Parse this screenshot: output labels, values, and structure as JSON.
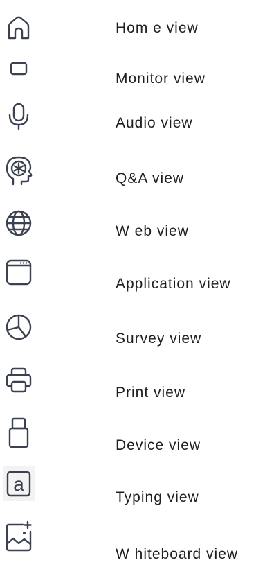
{
  "views": [
    {
      "label": "Hom e view",
      "icon": "home-icon"
    },
    {
      "label": "Monitor view",
      "icon": "monitor-icon"
    },
    {
      "label": "Audio view",
      "icon": "microphone-icon"
    },
    {
      "label": "Q&A view",
      "icon": "head-asterisk-icon"
    },
    {
      "label": "W eb view",
      "icon": "globe-icon"
    },
    {
      "label": "Application view",
      "icon": "application-window-icon"
    },
    {
      "label": "Survey view",
      "icon": "pie-chart-icon"
    },
    {
      "label": "Print view",
      "icon": "printer-icon"
    },
    {
      "label": "Device view",
      "icon": "usb-device-icon"
    },
    {
      "label": "Typing view",
      "icon": "letter-a-box-icon"
    },
    {
      "label": "W hiteboard view",
      "icon": "whiteboard-image-icon"
    }
  ],
  "colors": {
    "icon": "#3b4150",
    "text": "#1f1f1f",
    "icon_bg": "#f3f3f3"
  }
}
